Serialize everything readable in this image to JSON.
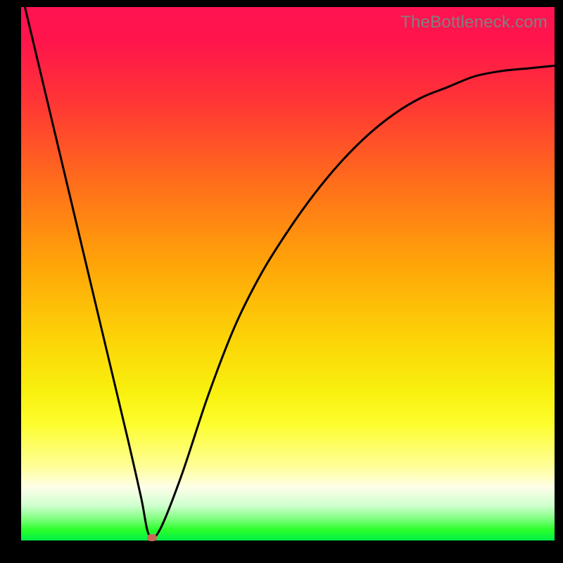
{
  "watermark": "TheBottleneck.com",
  "chart_data": {
    "type": "line",
    "title": "",
    "xlabel": "",
    "ylabel": "",
    "xlim": [
      0,
      1
    ],
    "ylim": [
      0,
      1
    ],
    "grid": false,
    "legend": false,
    "series": [
      {
        "name": "bottleneck-curve",
        "x": [
          0.0,
          0.05,
          0.1,
          0.15,
          0.2,
          0.225,
          0.24,
          0.26,
          0.3,
          0.35,
          0.4,
          0.45,
          0.5,
          0.55,
          0.6,
          0.65,
          0.7,
          0.75,
          0.8,
          0.85,
          0.9,
          0.95,
          1.0
        ],
        "values": [
          1.03,
          0.82,
          0.61,
          0.4,
          0.19,
          0.08,
          0.01,
          0.02,
          0.12,
          0.27,
          0.4,
          0.5,
          0.58,
          0.65,
          0.71,
          0.76,
          0.8,
          0.83,
          0.85,
          0.87,
          0.88,
          0.885,
          0.89
        ]
      }
    ],
    "marker": {
      "x": 0.245,
      "y": 0.006
    },
    "background_gradient": {
      "from": "#ff1351",
      "to": "#00ee47",
      "stops": [
        "#ff1351",
        "#ff3635",
        "#ff6a1c",
        "#ffa409",
        "#fcd307",
        "#f8f00e",
        "#fdfd2c",
        "#fefe97",
        "#fefee8",
        "#ceffce",
        "#7eff7e",
        "#2bff2b",
        "#00ee47"
      ]
    }
  },
  "colors": {
    "frame": "#000000",
    "curve": "#000000",
    "marker": "#cc6658",
    "watermark": "#808080"
  }
}
